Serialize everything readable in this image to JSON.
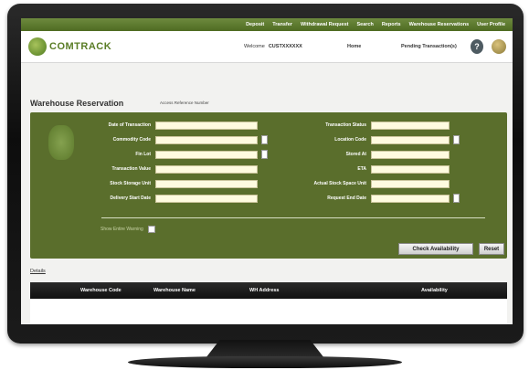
{
  "nav": {
    "items": [
      "Deposit",
      "Transfer",
      "Withdrawal Request",
      "Search",
      "Reports",
      "Warehouse Reservations",
      "User Profile"
    ]
  },
  "header": {
    "logo_text": "COMTRACK",
    "welcome_label": "Welcome",
    "username": "CUSTXXXXXX",
    "home_label": "Home",
    "pending_label": "Pending Transaction(s)",
    "help_icon": "?"
  },
  "page": {
    "title": "Warehouse Reservation",
    "account_label": "Access Reference Number"
  },
  "form": {
    "left_fields": [
      "Date of Transaction",
      "Commodity Code",
      "Fin Lot",
      "Transaction Value",
      "Stock Storage Unit",
      "Delivery Start Date"
    ],
    "right_fields": [
      "Transaction Status",
      "Location Code",
      "Stored At",
      "ETA",
      "Actual Stock Space Unit",
      "Request End Date"
    ],
    "checkbox_label": "Show Entire Warning"
  },
  "buttons": {
    "check": "Check Availability",
    "reset": "Reset"
  },
  "details_link": "Details",
  "table": {
    "headers": [
      "Warehouse Code",
      "Warehouse Name",
      "WH Address",
      "Availability"
    ]
  },
  "colors": {
    "nav": "#5d7a2f",
    "panel": "#5a6e2c",
    "input": "#fffbe0"
  }
}
